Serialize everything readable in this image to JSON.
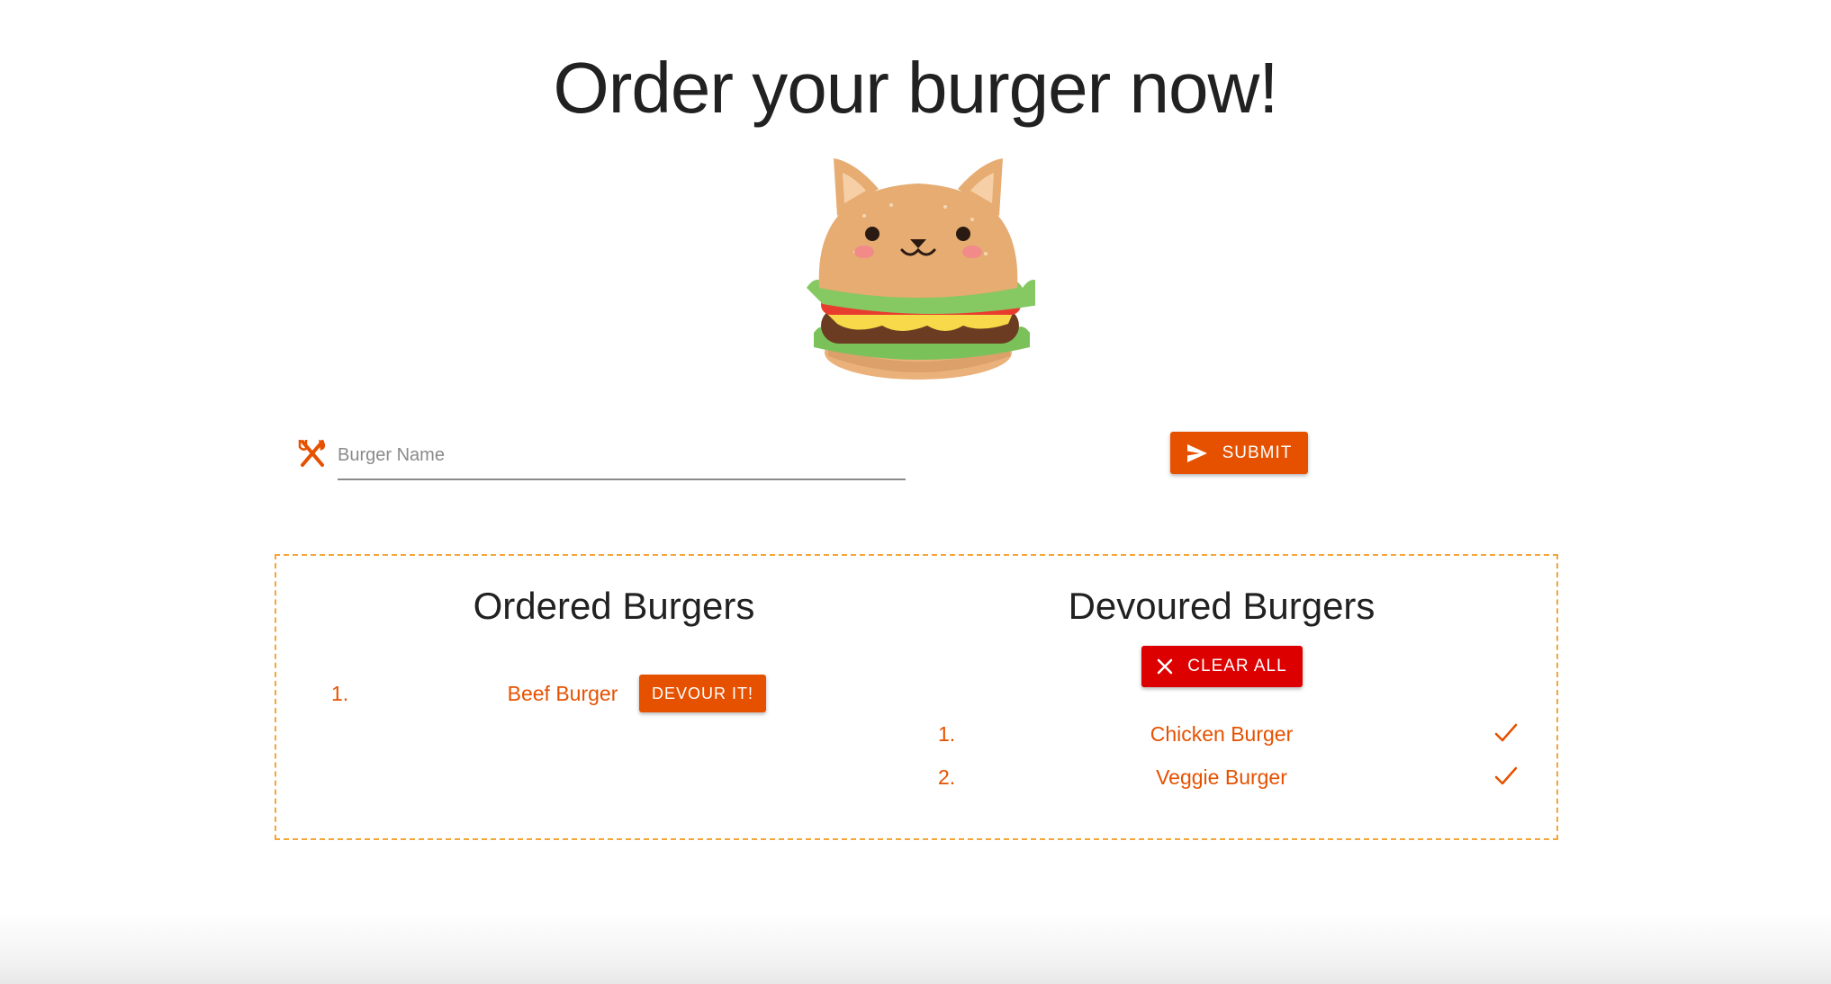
{
  "header": {
    "title": "Order your burger now!"
  },
  "mascot": {
    "icon": "cat-burger-illustration"
  },
  "form": {
    "input_placeholder": "Burger Name",
    "input_value": "",
    "input_icon": "fork-knife-icon",
    "submit_label": "SUBMIT",
    "submit_icon": "send-icon"
  },
  "ordered": {
    "title": "Ordered Burgers",
    "items": [
      {
        "number": "1.",
        "name": "Beef Burger",
        "action_label": "DEVOUR IT!"
      }
    ]
  },
  "devoured": {
    "title": "Devoured Burgers",
    "clear_label": "CLEAR ALL",
    "clear_icon": "close-icon",
    "items": [
      {
        "number": "1.",
        "name": "Chicken Burger",
        "icon": "check-icon"
      },
      {
        "number": "2.",
        "name": "Veggie Burger",
        "icon": "check-icon"
      }
    ]
  },
  "colors": {
    "accent": "#e65100",
    "danger": "#dd0000",
    "panel_border": "#f4a63a",
    "text": "#212121"
  }
}
